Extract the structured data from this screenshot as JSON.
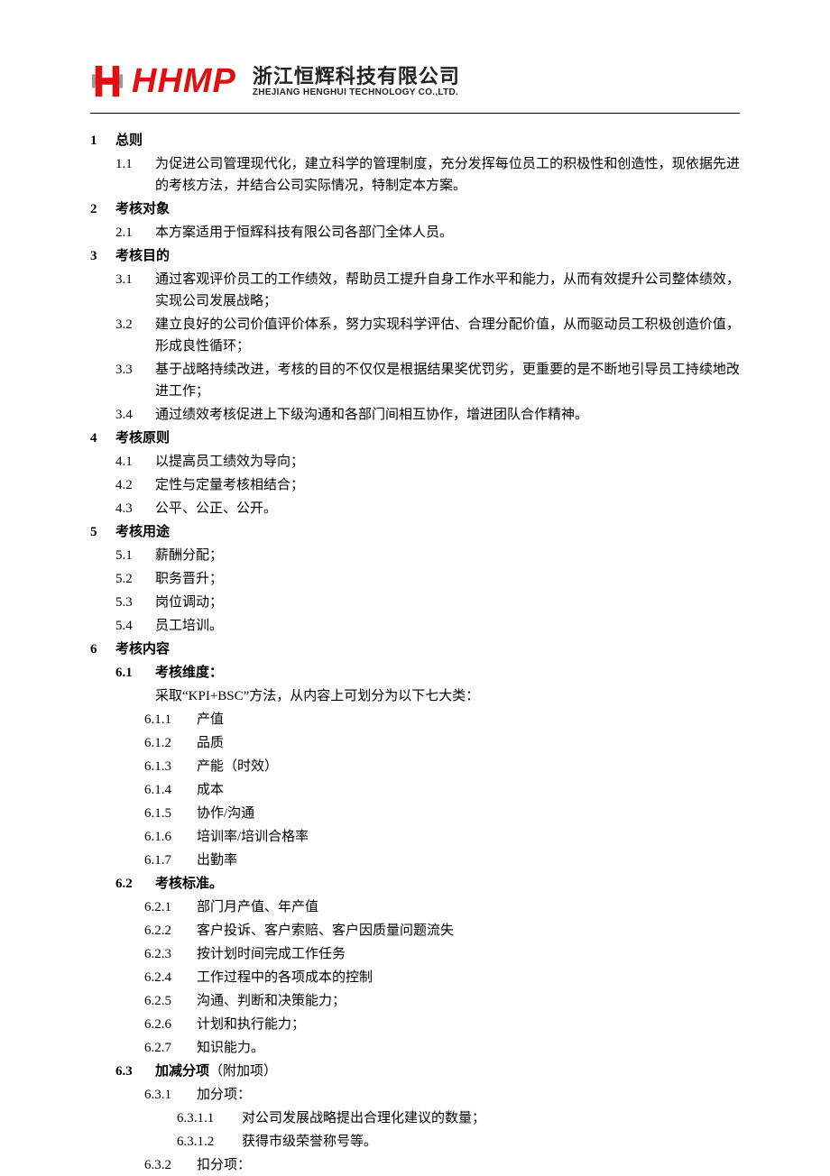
{
  "header": {
    "logo_text": "HHMP",
    "company_cn": "浙江恒辉科技有限公司",
    "company_en": "ZHEJIANG HENGHUI TECHNOLOGY CO.,LTD."
  },
  "s1": {
    "num": "1",
    "title": "总则",
    "i1_num": "1.1",
    "i1_text": "为促进公司管理现代化，建立科学的管理制度，充分发挥每位员工的积极性和创造性，现依据先进的考核方法，并结合公司实际情况，特制定本方案。"
  },
  "s2": {
    "num": "2",
    "title": "考核对象",
    "i1_num": "2.1",
    "i1_text": "本方案适用于恒辉科技有限公司各部门全体人员。"
  },
  "s3": {
    "num": "3",
    "title": "考核目的",
    "i1_num": "3.1",
    "i1_text": "通过客观评价员工的工作绩效，帮助员工提升自身工作水平和能力，从而有效提升公司整体绩效，实现公司发展战略；",
    "i2_num": "3.2",
    "i2_text": "建立良好的公司价值评价体系，努力实现科学评估、合理分配价值，从而驱动员工积极创造价值，形成良性循环；",
    "i3_num": "3.3",
    "i3_text": "基于战略持续改进，考核的目的不仅仅是根据结果奖优罚劣，更重要的是不断地引导员工持续地改进工作；",
    "i4_num": "3.4",
    "i4_text": "通过绩效考核促进上下级沟通和各部门间相互协作，增进团队合作精神。"
  },
  "s4": {
    "num": "4",
    "title": "考核原则",
    "i1_num": "4.1",
    "i1_text": "以提高员工绩效为导向；",
    "i2_num": "4.2",
    "i2_text": "定性与定量考核相结合；",
    "i3_num": "4.3",
    "i3_text": "公平、公正、公开。"
  },
  "s5": {
    "num": "5",
    "title": "考核用途",
    "i1_num": "5.1",
    "i1_text": "薪酬分配；",
    "i2_num": "5.2",
    "i2_text": "职务晋升；",
    "i3_num": "5.3",
    "i3_text": "岗位调动；",
    "i4_num": "5.4",
    "i4_text": "员工培训。"
  },
  "s6": {
    "num": "6",
    "title": "考核内容",
    "h1_num": "6.1",
    "h1_title": "考核维度：",
    "h1_intro": "采取“KPI+BSC”方法，从内容上可划分为以下七大类：",
    "h1_s1_num": "6.1.1",
    "h1_s1_text": "产值",
    "h1_s2_num": "6.1.2",
    "h1_s2_text": "品质",
    "h1_s3_num": "6.1.3",
    "h1_s3_text": "产能（时效）",
    "h1_s4_num": "6.1.4",
    "h1_s4_text": "成本",
    "h1_s5_num": "6.1.5",
    "h1_s5_text": "协作/沟通",
    "h1_s6_num": "6.1.6",
    "h1_s6_text": "培训率/培训合格率",
    "h1_s7_num": "6.1.7",
    "h1_s7_text": "出勤率",
    "h2_num": "6.2",
    "h2_title": "考核标准。",
    "h2_s1_num": "6.2.1",
    "h2_s1_text": "部门月产值、年产值",
    "h2_s2_num": "6.2.2",
    "h2_s2_text": "客户投诉、客户索赔、客户因质量问题流失",
    "h2_s3_num": "6.2.3",
    "h2_s3_text": "按计划时间完成工作任务",
    "h2_s4_num": "6.2.4",
    "h2_s4_text": "工作过程中的各项成本的控制",
    "h2_s5_num": "6.2.5",
    "h2_s5_text": "沟通、判断和决策能力；",
    "h2_s6_num": "6.2.6",
    "h2_s6_text": "计划和执行能力；",
    "h2_s7_num": "6.2.7",
    "h2_s7_text": "知识能力。",
    "h3_num": "6.3",
    "h3_title_bold": "加减分项",
    "h3_title_normal": "（附加项）",
    "h3_s1_num": "6.3.1",
    "h3_s1_text": "加分项：",
    "h3_s1_ss1_num": "6.3.1.1",
    "h3_s1_ss1_text": "对公司发展战略提出合理化建议的数量；",
    "h3_s1_ss2_num": "6.3.1.2",
    "h3_s1_ss2_text": "获得市级荣誉称号等。",
    "h3_s2_num": "6.3.2",
    "h3_s2_text": "扣分项："
  }
}
